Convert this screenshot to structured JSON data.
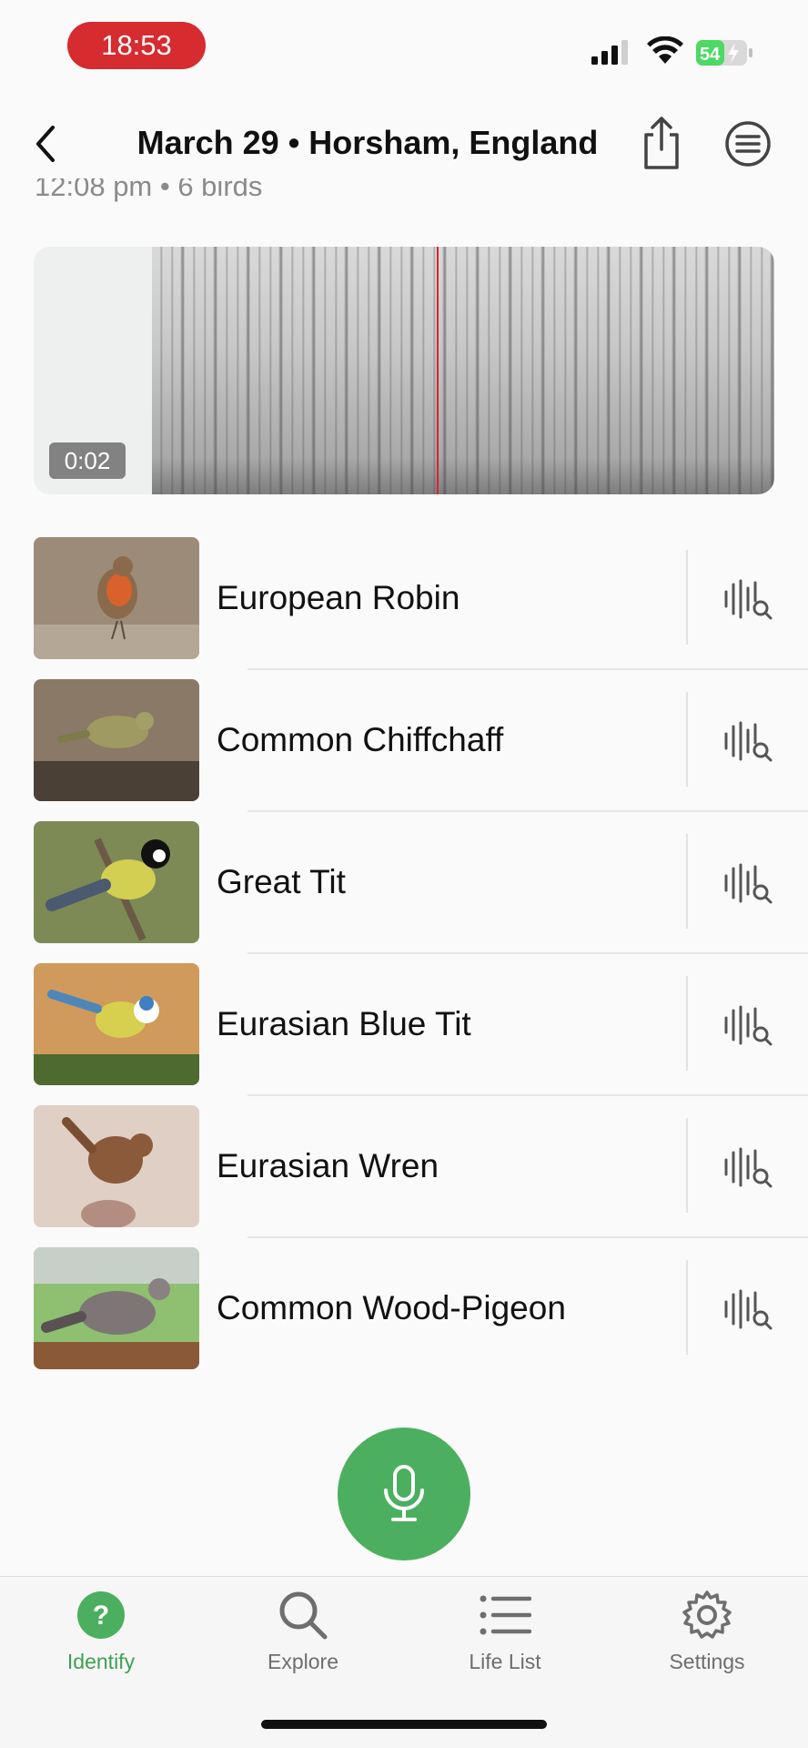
{
  "status_bar": {
    "time": "18:53",
    "battery_level": "54",
    "icons": [
      "signal-icon",
      "wifi-icon",
      "battery-charging-icon"
    ]
  },
  "nav": {
    "title": "March 29 • Horsham, England",
    "icons": [
      "back-chevron-icon",
      "share-icon",
      "menu-icon"
    ]
  },
  "session": {
    "subtitle": "12:08 pm • 6 birds"
  },
  "spectrogram": {
    "time_label": "0:02",
    "playhead_color": "#d8232a"
  },
  "birds": [
    {
      "name": "European Robin",
      "thumb_color": "#8a7560"
    },
    {
      "name": "Common Chiffchaff",
      "thumb_color": "#7a6a55"
    },
    {
      "name": "Great Tit",
      "thumb_color": "#7b8a4a"
    },
    {
      "name": "Eurasian Blue Tit",
      "thumb_color": "#c99a62"
    },
    {
      "name": "Eurasian Wren",
      "thumb_color": "#d9c8bd"
    },
    {
      "name": "Common Wood-Pigeon",
      "thumb_color": "#8fbf70"
    }
  ],
  "record_button": {
    "icon": "microphone-icon",
    "color": "#4caf5f"
  },
  "tabs": [
    {
      "label": "Identify",
      "icon": "question-circle-icon",
      "active": true
    },
    {
      "label": "Explore",
      "icon": "search-icon",
      "active": false
    },
    {
      "label": "Life List",
      "icon": "list-icon",
      "active": false
    },
    {
      "label": "Settings",
      "icon": "gear-icon",
      "active": false
    }
  ],
  "colors": {
    "accent_green": "#4caf5f",
    "active_tab": "#3f9f52",
    "status_time_bg": "#d62b2f"
  }
}
